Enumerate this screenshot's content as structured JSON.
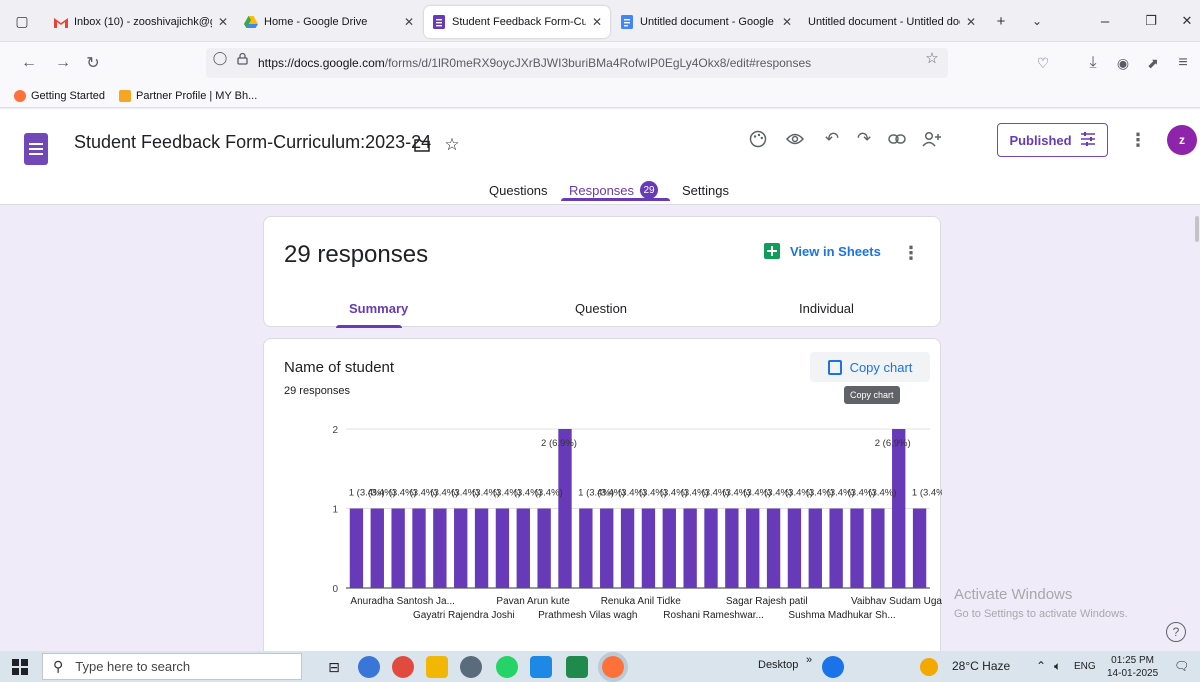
{
  "browser": {
    "tabs": [
      {
        "title": "Inbox (10) - zooshivajichk@g",
        "icon": "gmail-icon",
        "active": false
      },
      {
        "title": "Home - Google Drive",
        "icon": "drive-icon",
        "active": false
      },
      {
        "title": "Student Feedback Form-Curri",
        "icon": "forms-icon",
        "active": true
      },
      {
        "title": "Untitled document - Google D",
        "icon": "docs-icon",
        "active": false
      },
      {
        "title": "Untitled document - Untitled doc",
        "icon": "none",
        "active": false
      }
    ],
    "url_host": "https://docs.google.com",
    "url_path": "/forms/d/1lR0meRX9oycJXrBJWI3buriBMa4RofwIP0EgLy4Okx8/edit#responses",
    "bookmarks": [
      "Getting Started",
      "Partner Profile | MY Bh..."
    ]
  },
  "form": {
    "title": "Student Feedback Form-Curriculum:2023-24",
    "published_label": "Published",
    "avatar_letter": "z",
    "tabs": {
      "questions": "Questions",
      "responses": "Responses",
      "settings": "Settings"
    },
    "responses_badge": "29"
  },
  "summary": {
    "count_label": "29 responses",
    "view_in_sheets": "View in Sheets",
    "subtabs": {
      "summary": "Summary",
      "question": "Question",
      "individual": "Individual"
    }
  },
  "question": {
    "title": "Name of student",
    "responses_label": "29 responses",
    "copy_chart_label": "Copy chart",
    "tooltip": "Copy chart"
  },
  "chart_data": {
    "type": "bar",
    "color": "#673ab7",
    "ylim": [
      0,
      2
    ],
    "yticks": [
      0,
      1,
      2
    ],
    "values": [
      1,
      1,
      1,
      1,
      1,
      1,
      1,
      1,
      1,
      1,
      2,
      1,
      1,
      1,
      1,
      1,
      1,
      1,
      1,
      1,
      1,
      1,
      1,
      1,
      1,
      1,
      2,
      1
    ],
    "bar_labels": [
      "1 (3.4%)",
      "(3.4%)",
      "(3.4%)",
      "(3.4%)",
      "(3.4%)",
      "(3.4%)",
      "(3.4%)",
      "(3.4%)",
      "(3.4%)",
      "(3.4%)",
      "2 (6.9%)",
      "1 (3.4%)",
      "(3.4%)",
      "(3.4%)",
      "(3.4%)",
      "(3.4%)",
      "(3.4%)",
      "(3.4%)",
      "(3.4%)",
      "(3.4%)",
      "(3.4%)",
      "(3.4%)",
      "(3.4%)",
      "(3.4%)",
      "(3.4%)",
      "(3.4%)",
      "2 (6.9%)",
      "1 (3.4%)"
    ],
    "x_tick_labels_row1": [
      {
        "bar": 0,
        "text": "Anuradha Santosh Ja..."
      },
      {
        "bar": 7,
        "text": "Pavan Arun kute"
      },
      {
        "bar": 12,
        "text": "Renuka Anil Tidke"
      },
      {
        "bar": 18,
        "text": "Sagar Rajesh patil"
      },
      {
        "bar": 24,
        "text": "Vaibhav Sudam Ugale"
      }
    ],
    "x_tick_labels_row2": [
      {
        "bar": 3,
        "text": "Gayatri Rajendra Joshi"
      },
      {
        "bar": 9,
        "text": "Prathmesh Vilas wagh"
      },
      {
        "bar": 15,
        "text": "Roshani Rameshwar..."
      },
      {
        "bar": 21,
        "text": "Sushma Madhukar Sh..."
      }
    ]
  },
  "watermark": {
    "title": "Activate Windows",
    "subtitle": "Go to Settings to activate Windows."
  },
  "taskbar": {
    "search_placeholder": "Type here to search",
    "desktop_label": "Desktop",
    "weather": "28°C  Haze",
    "language": "ENG",
    "time": "01:25 PM",
    "date": "14-01-2025"
  }
}
